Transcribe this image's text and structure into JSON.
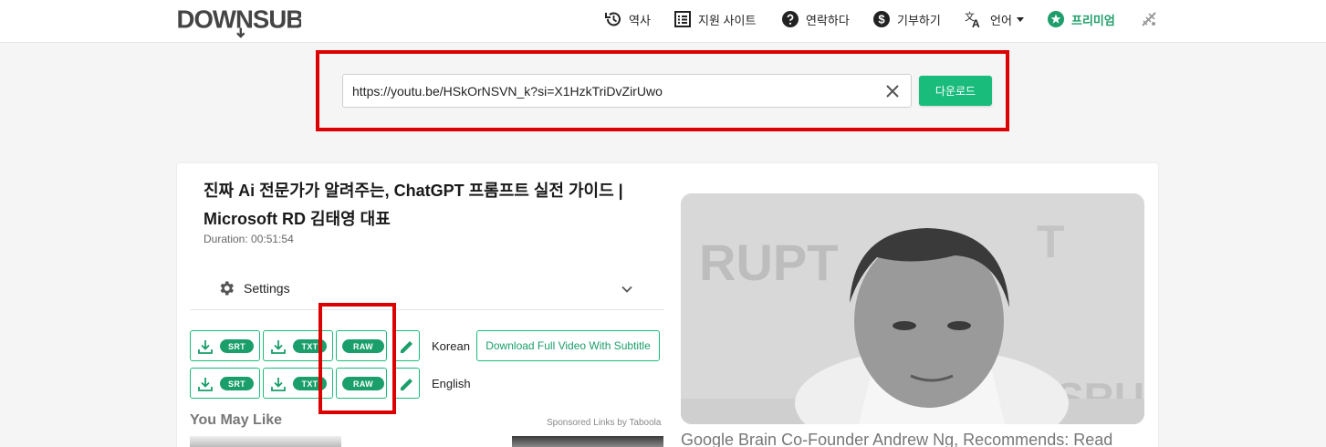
{
  "header": {
    "logo_text": "DOWNSUB",
    "nav": {
      "history": "역사",
      "supported_sites": "지원 사이트",
      "contact": "연락하다",
      "donate": "기부하기",
      "language": "언어",
      "premium": "프리미엄"
    }
  },
  "search": {
    "url_value": "https://youtu.be/HSkOrNSVN_k?si=X1HzkTriDvZirUwo",
    "download_label": "다운로드"
  },
  "video": {
    "title": "진짜 Ai 전문가가 알려주는, ChatGPT 프롬프트 실전 가이드 | Microsoft RD 김태영 대표",
    "duration": "Duration: 00:51:54",
    "settings_label": "Settings"
  },
  "subtitles": [
    {
      "language": "Korean",
      "formats": [
        "SRT",
        "TXT",
        "RAW"
      ]
    },
    {
      "language": "English",
      "formats": [
        "SRT",
        "TXT",
        "RAW"
      ]
    }
  ],
  "full_video_button": "Download Full Video With Subtitle",
  "recommendations": {
    "heading": "You May Like",
    "sponsored": "Sponsored Links by Taboola",
    "ad_title": "Google Brain Co-Founder Andrew Ng, Recommends: Read"
  },
  "colors": {
    "accent": "#1abc7b",
    "accent_dark": "#1a9e6a",
    "highlight": "#dd0000"
  }
}
